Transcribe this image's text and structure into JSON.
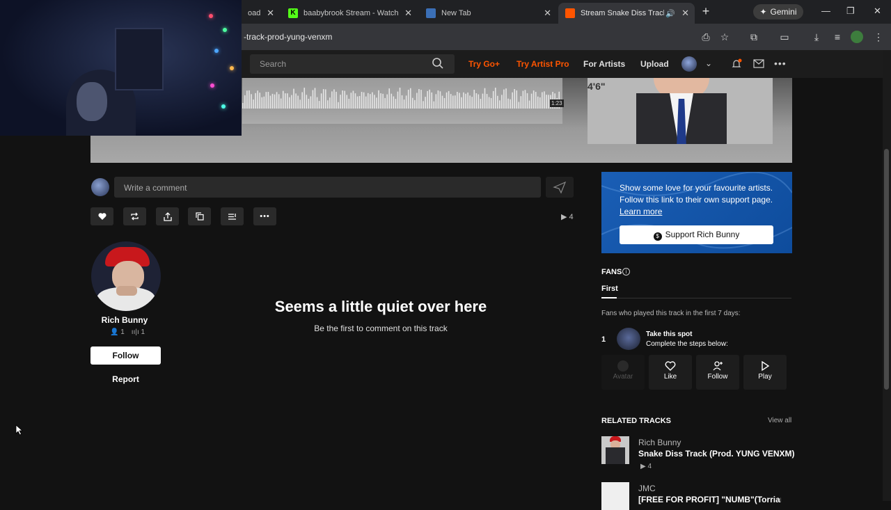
{
  "browser": {
    "tabs": [
      {
        "label": "oad"
      },
      {
        "label": "baabybrook Stream - Watch Liv"
      },
      {
        "label": "New Tab"
      },
      {
        "label": "Stream Snake Diss Track (Pr"
      }
    ],
    "gemini_label": "Gemini",
    "url": "-track-prod-yung-venxm"
  },
  "header": {
    "search_placeholder": "Search",
    "try_go": "Try Go+",
    "try_artist_pro": "Try Artist Pro",
    "for_artists": "For Artists",
    "upload": "Upload"
  },
  "player": {
    "time": "1:23",
    "artwork_caption": "4'6\""
  },
  "comment": {
    "placeholder": "Write a comment",
    "plays": "4"
  },
  "artist": {
    "name": "Rich Bunny",
    "followers": "1",
    "tracks": "1",
    "follow_label": "Follow",
    "report_label": "Report"
  },
  "empty_state": {
    "title": "Seems a little quiet over here",
    "subtitle": "Be the first to comment on this track"
  },
  "support": {
    "text": "Show some love for your favourite artists. Follow this link to their own support page.",
    "learn_more": "Learn more",
    "button": "Support Rich Bunny"
  },
  "fans": {
    "heading": "FANS",
    "tab": "First",
    "description": "Fans who played this track in the first 7 days:",
    "rank": "1",
    "take_title": "Take this spot",
    "take_subtitle": "Complete the steps below:",
    "steps": [
      {
        "label": "Avatar"
      },
      {
        "label": "Like"
      },
      {
        "label": "Follow"
      },
      {
        "label": "Play"
      }
    ]
  },
  "related": {
    "heading": "RELATED TRACKS",
    "view_all": "View all",
    "tracks": [
      {
        "artist": "Rich Bunny",
        "title": "Snake Diss Track (Prod. YUNG VENXM)",
        "plays": "4"
      },
      {
        "artist": "JMC",
        "title": "[FREE FOR PROFIT] \"NUMB\"(Torrian B"
      }
    ]
  },
  "colors": {
    "accent": "#ff5500",
    "support_blue": "#1a5eb5",
    "background": "#121212"
  }
}
